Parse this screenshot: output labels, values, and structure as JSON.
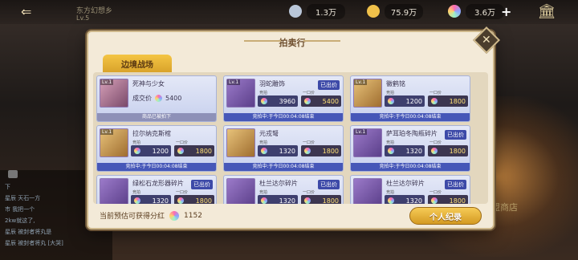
{
  "top": {
    "back_label": "⇐",
    "location_name": "东方幻想乡",
    "location_level": "Lv.5",
    "resources": [
      {
        "icon": "silver-gem-icon",
        "value": "1.3万",
        "color": "#b9c6d8"
      },
      {
        "icon": "gold-coin-icon",
        "value": "75.9万",
        "color": "#f0c14a"
      },
      {
        "icon": "rainbow-gem-icon",
        "value": "3.6万",
        "color": "#c77dff"
      }
    ],
    "plus_label": "+",
    "temple_label": "🏛"
  },
  "chat": {
    "lines": [
      "下",
      "星辰 天石一方",
      "市 我把一个",
      "2kw就这了,",
      "星辰 被封者将丸是",
      "星辰 被封者将丸 [大哭]"
    ]
  },
  "side_label": "盟商店",
  "panel": {
    "title": "拍卖行",
    "close_label": "✕",
    "tab": "边境战场",
    "cards": [
      {
        "name": "死神与少女",
        "type": "done",
        "deal_label": "成交价",
        "deal_price": "5400",
        "footer": "商品已被拍下",
        "lv": "Lv.1",
        "thumb": "pink"
      },
      {
        "name": "羽蛇雕饰",
        "type": "active",
        "badge": "已出价",
        "bid_label": "竞拍",
        "bid": "3960",
        "buy_label": "一口价",
        "buy": "5400",
        "footer": "竞拍中:于今日00:04:08结束",
        "lv": "Lv.1",
        "thumb": "purple"
      },
      {
        "name": "徽鹤铭",
        "type": "active",
        "badge": "",
        "bid_label": "竞拍",
        "bid": "1200",
        "buy_label": "一口价",
        "buy": "1800",
        "footer": "竞拍中:于今日00:04:08结束",
        "lv": "Lv.1",
        "thumb": "gold"
      },
      {
        "name": "拉尔纳克斯棺",
        "type": "active",
        "badge": "",
        "bid_label": "竞拍",
        "bid": "1200",
        "buy_label": "一口价",
        "buy": "1800",
        "footer": "竞拍中:于今日00:04:08结束",
        "lv": "Lv.1",
        "thumb": "gold"
      },
      {
        "name": "元戎弩",
        "type": "active",
        "badge": "",
        "bid_label": "竞拍",
        "bid": "1320",
        "buy_label": "一口价",
        "buy": "1800",
        "footer": "竞拍中:于今日00:04:08结束",
        "lv": "",
        "thumb": "gold"
      },
      {
        "name": "萨耳珀冬陶瓶碎片",
        "type": "active",
        "badge": "已出价",
        "bid_label": "竞拍",
        "bid": "1320",
        "buy_label": "一口价",
        "buy": "1800",
        "footer": "竞拍中:于今日00:04:08结束",
        "lv": "Lv.1",
        "thumb": "purple"
      },
      {
        "name": "绿松石龙形器碎片",
        "type": "active",
        "badge": "已出价",
        "bid_label": "竞拍",
        "bid": "1320",
        "buy_label": "一口价",
        "buy": "1800",
        "footer": "",
        "lv": "",
        "thumb": "purple"
      },
      {
        "name": "杜兰达尔碎片",
        "type": "active",
        "badge": "已出价",
        "bid_label": "竞拍",
        "bid": "1320",
        "buy_label": "一口价",
        "buy": "1800",
        "footer": "",
        "lv": "",
        "thumb": "purple"
      },
      {
        "name": "杜兰达尔碎片",
        "type": "active",
        "badge": "已出价",
        "bid_label": "竞拍",
        "bid": "1320",
        "buy_label": "一口价",
        "buy": "1800",
        "footer": "",
        "lv": "",
        "thumb": "purple"
      }
    ],
    "footer_label": "当前预估可获得分红",
    "footer_value": "1152",
    "record_button": "个人纪录"
  }
}
